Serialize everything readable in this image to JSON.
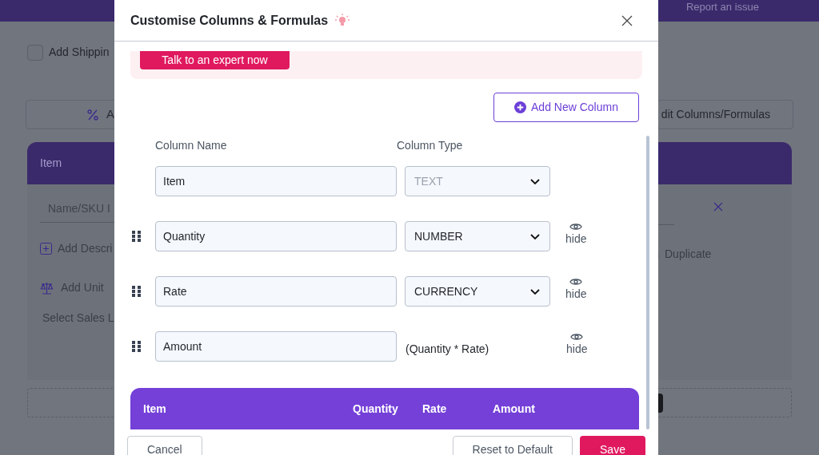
{
  "background": {
    "report_link": "Report an issue",
    "shipping_label": "Add Shippin",
    "shipping_checked": false,
    "left_button": "A",
    "right_button": "dit Columns/Formulas",
    "table_header": "Item",
    "name_placeholder": "Name/SKU I",
    "add_description": "Add Descri",
    "add_unit": "Add Unit",
    "sales_ledger": "Select Sales L",
    "duplicate": "Duplicate"
  },
  "modal": {
    "title": "Customise Columns & Formulas",
    "banner_button": "Talk to an expert now",
    "add_button": "Add New Column",
    "headings": [
      "Column Name",
      "Column Type"
    ],
    "columns": [
      {
        "kind": "fixed",
        "name": "Item",
        "type": "TEXT",
        "disabled": true
      },
      {
        "kind": "select",
        "name": "Quantity",
        "type": "NUMBER",
        "disabled": false,
        "hide_label": "hide"
      },
      {
        "kind": "select",
        "name": "Rate",
        "type": "CURRENCY",
        "disabled": false,
        "hide_label": "hide"
      },
      {
        "kind": "formula",
        "name": "Amount",
        "formula": "(Quantity * Rate)",
        "hide_label": "hide"
      }
    ],
    "preview_headers": [
      "Item",
      "Quantity",
      "Rate",
      "Amount"
    ],
    "footer_buttons": [
      {
        "kind": "secondary",
        "label": "Cancel"
      },
      {
        "kind": "secondary",
        "label": "Reset to Default"
      },
      {
        "kind": "primary",
        "label": "Save"
      }
    ]
  }
}
